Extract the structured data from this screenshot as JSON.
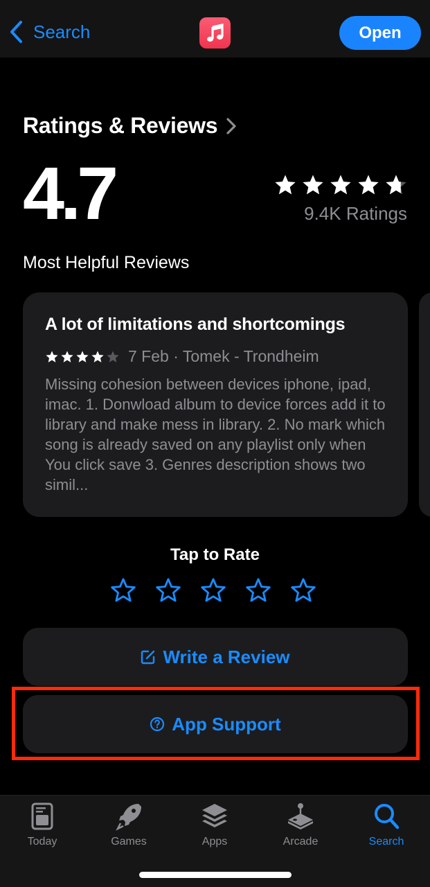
{
  "navbar": {
    "back_label": "Search",
    "app_icon": "music-note-icon",
    "open_label": "Open"
  },
  "ratings": {
    "title": "Ratings & Reviews",
    "average": "4.7",
    "average_value": 4.7,
    "max_stars": 5,
    "count_label": "9.4K Ratings"
  },
  "reviews": {
    "title": "Most Helpful Reviews",
    "items": [
      {
        "title": "A lot of limitations and shortcomings",
        "stars": 4,
        "date": "7 Feb",
        "author": "Tomek - Trondheim",
        "meta": "7 Feb · Tomek - Trondheim",
        "body": "Missing cohesion between devices iphone, ipad, imac. 1. Donwload album to device forces add it to library and make mess in library. 2. No mark which song is already saved on any playlist only when You click save 3. Genres description shows two simil..."
      }
    ]
  },
  "tap_to_rate": {
    "label": "Tap to Rate",
    "selected": 0
  },
  "actions": {
    "write_review": "Write a Review",
    "app_support": "App Support"
  },
  "tabbar": {
    "items": [
      {
        "label": "Today",
        "icon": "today-icon",
        "active": false
      },
      {
        "label": "Games",
        "icon": "rocket-icon",
        "active": false
      },
      {
        "label": "Apps",
        "icon": "layers-icon",
        "active": false
      },
      {
        "label": "Arcade",
        "icon": "joystick-icon",
        "active": false
      },
      {
        "label": "Search",
        "icon": "search-icon",
        "active": true
      }
    ]
  },
  "colors": {
    "accent": "#1a8cff",
    "highlight": "#ff2a0a",
    "card": "#1c1c1e",
    "secondary_text": "#8e8e93"
  }
}
